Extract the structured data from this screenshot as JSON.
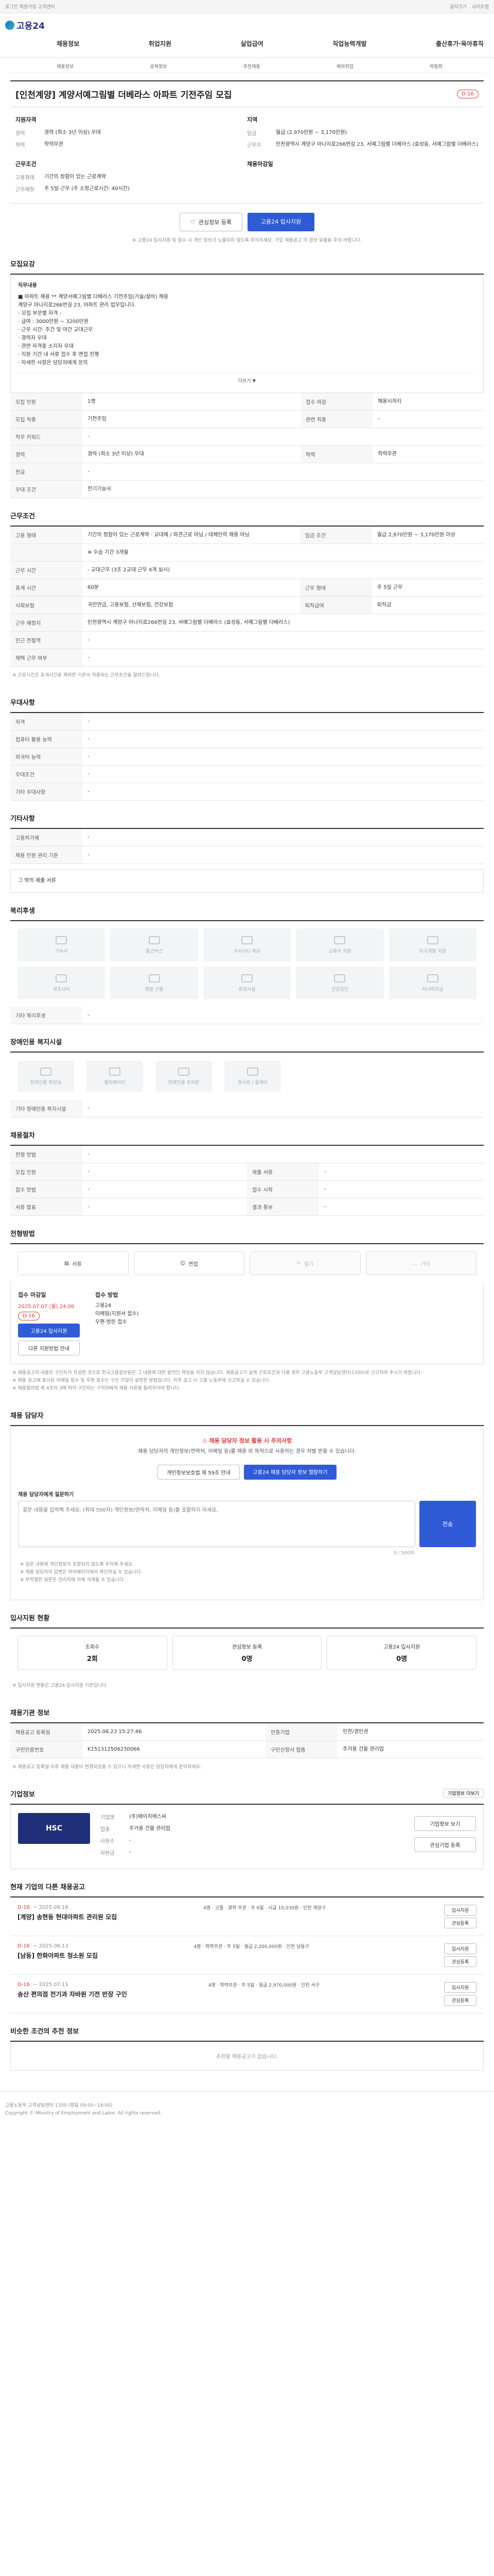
{
  "topbar": {
    "left": "로그인 회원가입 고객센터",
    "right": [
      "글자크기",
      "사이트맵"
    ]
  },
  "header": {
    "logo": "고용24",
    "nav": [
      "채용정보",
      "취업지원",
      "실업급여",
      "직업능력개발",
      "출산휴가·육아휴직"
    ]
  },
  "subnav": [
    "채용정보",
    "공채정보",
    "추천채용",
    "해외취업",
    "박람회"
  ],
  "job": {
    "title": "[인천계양] 계양서예그림별 더베라스 아파트 기전주임 모집",
    "dday": "D-16",
    "applicant_label": "지원자격",
    "applicant": [
      {
        "k": "경력",
        "v": "경력 (최소 3년 이상) 우대"
      },
      {
        "k": "학력",
        "v": "학력무관"
      }
    ],
    "condition_label": "근무조건",
    "condition": [
      {
        "k": "고용형태",
        "v": "기간의 정함이 있는 근로계약"
      },
      {
        "k": "근무예정",
        "v": "주 5일 근무 (주 소정근로시간: 40시간)"
      }
    ],
    "right_label": "지역",
    "right": [
      {
        "k": "임금",
        "v": "월급 (2,970만원 ~ 3,170만원)"
      },
      {
        "k": "근무지",
        "v": "인천광역시 계양구 아나지로266번길 23, 서예그림별 더베라스 (효성동, 서예그림별 더베라스)"
      }
    ],
    "time_label": "채용마감일",
    "save_button": "관심정보 등록",
    "apply_button": "고용24 입사지원",
    "notice": "※ 고용24 입사지원 및 접수 시 개인 정보가 노출되지 않도록 주의하세요. 기업 채용공고 의 정보 유출을 주의 바랍니다."
  },
  "sections": {
    "detail_title": "모집요강",
    "detail_sub": "직무내용",
    "detail_lines": [
      "■ 아파트 채용 ** 계양서예그림별 더베라스 기전주임(기술/설비) 채용",
      "계양구 아나지로266번길 23, 아파트 관리 업무입니다.",
      "- 모집 부문별 자격 :",
      "· 급여 : 3000만원 ~ 3200만원",
      "· 근무 시간: 주간 및 야간 교대근무",
      "· 경력자 우대",
      "· 관련 자격증 소지자 우대",
      "· 지원 기간 내 서류 접수 후 면접 진행",
      "· 자세한 사항은 담당자에게 문의"
    ],
    "toggle": "더보기 ▼",
    "req_table": [
      {
        "k": "모집 인원",
        "v": "1명",
        "k2": "접수 마감",
        "v2": "채용시까지"
      },
      {
        "k": "모집 직종",
        "v": "기전주임",
        "k2": "관련 직종",
        "v2": "-"
      },
      {
        "k": "직무 키워드",
        "v": "-",
        "k2": "",
        "v2": ""
      },
      {
        "k": "경력",
        "v": "경력 (최소 3년 이상) 우대",
        "k2": "학력",
        "v2": "학력무관"
      },
      {
        "k": "전공",
        "v": "-",
        "k2": "",
        "v2": ""
      },
      {
        "k": "우대 조건",
        "v": "전기기능사",
        "k2": "",
        "v2": ""
      }
    ],
    "work_title": "근무조건",
    "work_table": [
      {
        "k": "고용 형태",
        "v": "기간의 정함이 있는 근로계약 · 교대제 / 파견근로 아님 / 대체인력 채용 아님",
        "k2": "임금 조건",
        "v2": "월급 2,970만원 ~ 3,170만원 이상"
      },
      {
        "k": "",
        "v": "※ 수습 기간 3개월",
        "k2": "",
        "v2": ""
      },
      {
        "k": "근무 시간",
        "v": "- 교대근무 (3조 2교대 근무 4개 실시)",
        "k2": "",
        "v2": ""
      },
      {
        "k": "휴게 시간",
        "v": "60분",
        "k2": "근무 형태",
        "v2": "주 5일 근무"
      },
      {
        "k": "사회보험",
        "v": "국민연금, 고용보험, 산재보험, 건강보험",
        "k2": "퇴직급여",
        "v2": "퇴직금"
      },
      {
        "k": "근무 예정지",
        "v": "인천광역시 계양구 아나지로266번길 23, 서예그림별 더베라스 (효성동, 서예그림별 더베라스)",
        "k2": "",
        "v2": ""
      },
      {
        "k": "인근 전철역",
        "v": "-",
        "k2": "",
        "v2": ""
      },
      {
        "k": "재택 근무 여부",
        "v": "-",
        "k2": "",
        "v2": ""
      }
    ],
    "map_button": "지도 보기",
    "work_note": "※ 근로시간은 휴게시간을 제외한 기준이 적용되는 근무조건을 알려드립니다.",
    "pref_title": "우대사항",
    "pref_table": [
      {
        "k": "자격",
        "v": "-"
      },
      {
        "k": "컴퓨터 활용 능력",
        "v": "-"
      },
      {
        "k": "외국어 능력",
        "v": "-"
      },
      {
        "k": "우대조건",
        "v": "-"
      },
      {
        "k": "기타 우대사항",
        "v": "-"
      }
    ],
    "etc_title": "기타사항",
    "etc_table": [
      {
        "k": "고용허가제",
        "v": "-"
      },
      {
        "k": "채용 인원 관리 기준",
        "v": "-"
      }
    ],
    "etc_more": "그 밖의 제출 서류",
    "welfare_title": "복리후생",
    "welfare": [
      "기숙사",
      "통근버스",
      "식사(비) 제공",
      "교육비 지원",
      "자기계발 지원",
      "경조사비",
      "명절 선물",
      "휴양시설",
      "건강검진",
      "자녀학자금"
    ],
    "welfare_etc": "기타 복리후생",
    "env_title": "장애인용 복지시설",
    "env": [
      "장애인용 화장실",
      "엘리베이터",
      "장애인용 주차장",
      "경사로 / 휠체어"
    ],
    "env_etc": "기타 장애인용 복지시설",
    "proc_title": "채용절차",
    "proc_table": [
      {
        "k": "전형 방법",
        "v": "-",
        "k2": "",
        "v2": ""
      },
      {
        "k": "모집 인원",
        "v": "-",
        "k2": "제출 서류",
        "v2": "-"
      },
      {
        "k": "접수 방법",
        "v": "-",
        "k2": "접수 시작",
        "v2": "-"
      },
      {
        "k": "서류 발표",
        "v": "-",
        "k2": "결과 통보",
        "v2": "-"
      }
    ],
    "media_title": "전형방법",
    "media": [
      "서류",
      "면접",
      "필기",
      "기타"
    ],
    "apply_title": "접수 마감일",
    "apply_date": "2025.07.07 (월) 24:00",
    "apply_dday": "D-16",
    "apply_btn1": "고용24 입사지원",
    "apply_btn2": "다른 지원방법 안내",
    "apply_method_title": "접수 방법",
    "apply_method": [
      "고용24",
      "이메일(지원서 접수)",
      "우편·방문 접수"
    ],
    "legal_lines": [
      "※ 채용공고의 내용은 구인자가 작성한 것으로 한국고용정보원은 그 내용에 대한 법적인 책임을 지지 않습니다. 채용공고가 실제 근로조건과 다를 경우 고용노동부 고객상담센터(1350)로 신고하여 주시기 바랍니다.",
      "※ 채용 공고에 표시된 이메일 접수 및 우편 접수는 구인 기업이 설정한 방법입니다. 허위 공고 시 고용 노동부에 신고하실 수 있습니다.",
      "※ 채용절차법 제 4조의 3에 따라 구인자는 구직자에게 채용 서류를 돌려주어야 합니다."
    ],
    "contact_title": "채용 담당자",
    "contact_warn": "채용 담당자 정보 활용 시 주의사항",
    "contact_text": "채용 담당자의 개인정보(연락처, 이메일 등)를 채용 외 목적으로 사용하는 경우 처벌 받을 수 있습니다.",
    "contact_btn1": "개인정보보호법 제 59조 안내",
    "contact_btn2": "고용24 채용 담당자 정보 열람하기",
    "qa_label": "채용 담당자에게 질문하기",
    "qa_placeholder": "질문 내용을 입력해 주세요. (최대 500자) 개인정보(연락처, 이메일 등)를 포함하지 마세요.",
    "qa_send": "전송",
    "qa_count": "0 / 500자",
    "qa_notes": [
      "※ 질문 내용에 개인정보가 포함되지 않도록 주의해 주세요.",
      "※ 채용 담당자의 답변은 마이페이지에서 확인하실 수 있습니다.",
      "※ 부적절한 질문은 관리자에 의해 삭제될 수 있습니다."
    ],
    "stats_title": "입사지원 현황",
    "stats": [
      {
        "label": "조회수",
        "value": "2회"
      },
      {
        "label": "관심정보 등록",
        "value": "0명"
      },
      {
        "label": "고용24 입사지원",
        "value": "0명"
      }
    ],
    "stats_note": "※ 입사지원 현황은 고용24 입사지원 기준입니다.",
    "info_title": "채용기관 정보",
    "info_table": [
      {
        "k": "채용공고 등록일",
        "v": "2025.06.23 15:27:46",
        "k2": "인증기업",
        "v2": "인천/경인권"
      },
      {
        "k": "구인인증번호",
        "v": "K151312506230066",
        "k2": "구인신청서 업종",
        "v2": "주거용 건물 관리업"
      }
    ],
    "info_btn": "지도 보기",
    "info_note": "※ 채용공고 등록일 이후 채용 내용이 변경되었을 수 있으니 자세한 사항은 담당자에게 문의하세요.",
    "company_title": "기업정보",
    "company_btn": "기업정보 더보기",
    "company_logo": "HSC",
    "company_rows": [
      {
        "k": "기업명",
        "v": "(주)에이치에스씨"
      },
      {
        "k": "업종",
        "v": "주거용 건물 관리업"
      },
      {
        "k": "사원수",
        "v": "-"
      },
      {
        "k": "자본금",
        "v": "-"
      }
    ],
    "company_btns": [
      "기업정보 보기",
      "관심기업 등록"
    ],
    "related_title": "현재 기업의 다른 채용공고",
    "related": [
      {
        "dd": "D-16",
        "date": "~ 2025.08.16",
        "title": "[계양] 송현동 현대아파트 관리원 모집",
        "info": "4명 · 고졸 · 경력 무관 · 주 6일 · 시급 10,030원 · 인천 계양구"
      },
      {
        "dd": "D-16",
        "date": "~ 2025.08.13",
        "title": "[남동] 한화아파트 청소원 모집",
        "info": "4명 · 학력무관 · 주 5일 · 월급 2,200,000원 · 인천 남동구"
      },
      {
        "dd": "D-16",
        "date": "~ 2025.07.11",
        "title": "송산 편의점 전기과 자바원 기전 반장 구인",
        "info": "4명 · 학력무관 · 주 5일 · 월급 2,970,000원 · 인천 서구"
      }
    ],
    "related_btns": [
      "입사지원",
      "관심등록"
    ],
    "similar_title": "비슷한 조건의 추천 정보",
    "similar_empty": "추천할 채용공고가 없습니다."
  },
  "footer": {
    "lines": [
      "고용노동부 고객상담센터 1350 (평일 09:00~18:00)",
      "Copyright © Ministry of Employment and Labor. All rights reserved."
    ]
  }
}
